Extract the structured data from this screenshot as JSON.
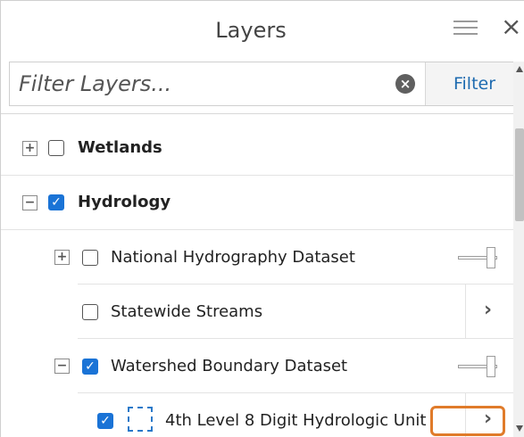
{
  "header": {
    "title": "Layers"
  },
  "filter": {
    "placeholder": "Filter Layers...",
    "button_label": "Filter"
  },
  "layers": [
    {
      "label": "Wetlands",
      "checked": false,
      "expander": "+"
    },
    {
      "label": "Hydrology",
      "checked": true,
      "expander": "−"
    },
    {
      "label": "National Hydrography Dataset",
      "checked": false,
      "expander": "+"
    },
    {
      "label": "Statewide Streams",
      "checked": false
    },
    {
      "label": "Watershed Boundary Dataset",
      "checked": true,
      "expander": "−"
    },
    {
      "label": "4th Level 8 Digit Hydrologic Unit",
      "checked": true
    }
  ],
  "colors": {
    "accent": "#1a73d6",
    "highlight": "#e07b2a",
    "filter_text": "#1e6bb0"
  },
  "icons": [
    "menu-icon",
    "close-icon",
    "clear-icon",
    "chevron-right-icon",
    "opacity-slider",
    "symbol-box"
  ]
}
